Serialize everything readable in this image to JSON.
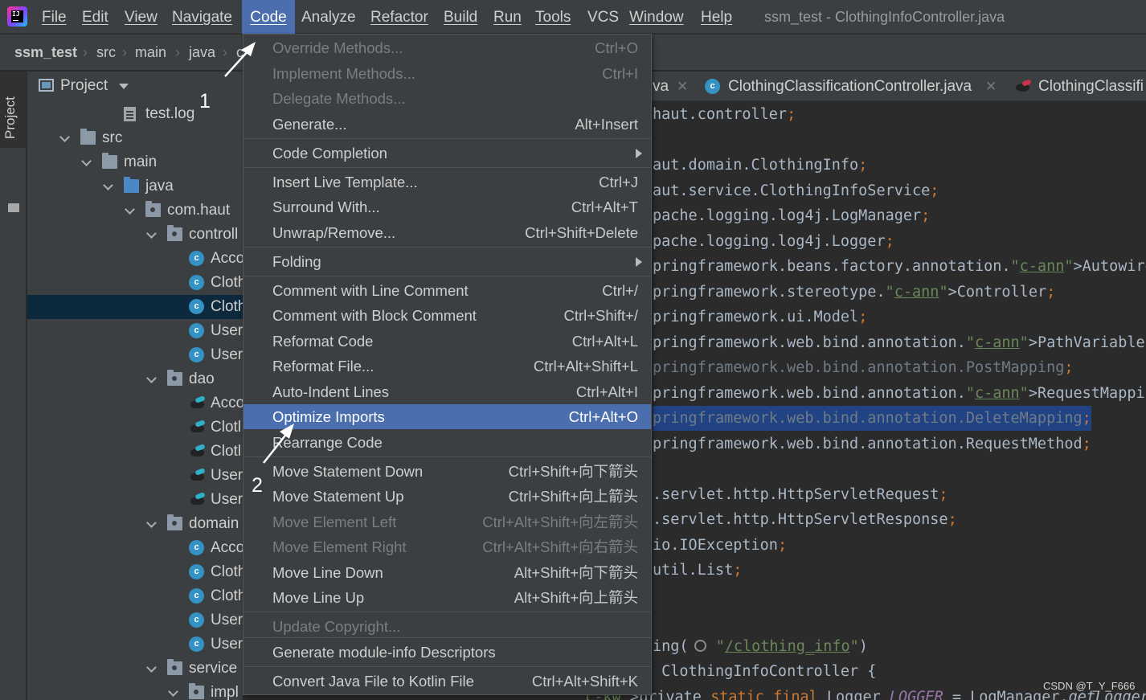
{
  "menubar": {
    "items": [
      "File",
      "Edit",
      "View",
      "Navigate",
      "Code",
      "Analyze",
      "Refactor",
      "Build",
      "Run",
      "Tools",
      "VCS",
      "Window",
      "Help"
    ],
    "active": "Code",
    "window_title": "ssm_test - ClothingInfoController.java"
  },
  "breadcrumb": [
    "ssm_test",
    "src",
    "main",
    "java",
    "c"
  ],
  "tool_strip": {
    "project_tab": "Project"
  },
  "project_panel": {
    "title": "Project",
    "tree": [
      {
        "label": "test.log",
        "icon": "file-icon"
      },
      {
        "label": "src",
        "icon": "folder-icon"
      },
      {
        "label": "main",
        "icon": "folder-icon"
      },
      {
        "label": "java",
        "icon": "source-folder-icon"
      },
      {
        "label": "com.haut",
        "icon": "package-icon"
      },
      {
        "label": "controll",
        "icon": "package-icon"
      },
      {
        "label": "Acco",
        "icon": "class-icon"
      },
      {
        "label": "Cloth",
        "icon": "class-icon"
      },
      {
        "label": "Cloth",
        "icon": "class-icon",
        "selected": true
      },
      {
        "label": "User",
        "icon": "class-icon"
      },
      {
        "label": "User",
        "icon": "class-icon"
      },
      {
        "label": "dao",
        "icon": "package-icon"
      },
      {
        "label": "Acco",
        "icon": "mapper-icon"
      },
      {
        "label": "Clotl",
        "icon": "mapper-icon"
      },
      {
        "label": "Clotl",
        "icon": "mapper-icon"
      },
      {
        "label": "User",
        "icon": "mapper-icon"
      },
      {
        "label": "User",
        "icon": "mapper-icon"
      },
      {
        "label": "domain",
        "icon": "package-icon"
      },
      {
        "label": "Acco",
        "icon": "class-icon"
      },
      {
        "label": "Cloth",
        "icon": "class-icon"
      },
      {
        "label": "Cloth",
        "icon": "class-icon"
      },
      {
        "label": "User",
        "icon": "class-icon"
      },
      {
        "label": "User",
        "icon": "class-icon"
      },
      {
        "label": "service",
        "icon": "package-icon"
      },
      {
        "label": "impl",
        "icon": "package-icon"
      }
    ]
  },
  "editor": {
    "tabs": [
      {
        "label": "va",
        "icon": "none"
      },
      {
        "label": "ClothingClassificationController.java",
        "icon": "class-icon"
      },
      {
        "label": "ClothingClassifi",
        "icon": "mapper-icon"
      }
    ],
    "code": [
      "haut.controller;",
      "",
      "aut.domain.ClothingInfo;",
      "aut.service.ClothingInfoService;",
      "pache.logging.log4j.LogManager;",
      "pache.logging.log4j.Logger;",
      "pringframework.beans.factory.annotation.Autowired;",
      "pringframework.stereotype.Controller;",
      "pringframework.ui.Model;",
      "pringframework.web.bind.annotation.PathVariable;",
      "pringframework.web.bind.annotation.PostMapping;",
      "pringframework.web.bind.annotation.RequestMapping;",
      "pringframework.web.bind.annotation.DeleteMapping;",
      "pringframework.web.bind.annotation.RequestMethod;",
      "",
      ".servlet.http.HttpServletRequest;",
      ".servlet.http.HttpServletResponse;",
      "io.IOException;",
      "util.List;",
      "",
      "",
      "ing(\"/clothing_info\")",
      " ClothingInfoController {",
      "private static final Logger LOGGER = LogManager.getLogger("
    ]
  },
  "code_menu": {
    "items": [
      {
        "label": "Override Methods...",
        "shortcut": "Ctrl+O",
        "disabled": true
      },
      {
        "label": "Implement Methods...",
        "shortcut": "Ctrl+I",
        "disabled": true
      },
      {
        "label": "Delegate Methods...",
        "shortcut": "",
        "disabled": true
      },
      {
        "label": "Generate...",
        "shortcut": "Alt+Insert"
      },
      {
        "label": "Code Completion",
        "shortcut": "",
        "submenu": true
      },
      {
        "label": "Insert Live Template...",
        "shortcut": "Ctrl+J"
      },
      {
        "label": "Surround With...",
        "shortcut": "Ctrl+Alt+T"
      },
      {
        "label": "Unwrap/Remove...",
        "shortcut": "Ctrl+Shift+Delete"
      },
      {
        "label": "Folding",
        "shortcut": "",
        "submenu": true
      },
      {
        "label": "Comment with Line Comment",
        "shortcut": "Ctrl+/"
      },
      {
        "label": "Comment with Block Comment",
        "shortcut": "Ctrl+Shift+/"
      },
      {
        "label": "Reformat Code",
        "shortcut": "Ctrl+Alt+L"
      },
      {
        "label": "Reformat File...",
        "shortcut": "Ctrl+Alt+Shift+L"
      },
      {
        "label": "Auto-Indent Lines",
        "shortcut": "Ctrl+Alt+I"
      },
      {
        "label": "Optimize Imports",
        "shortcut": "Ctrl+Alt+O",
        "highlighted": true
      },
      {
        "label": "Rearrange Code",
        "shortcut": ""
      },
      {
        "label": "Move Statement Down",
        "shortcut": "Ctrl+Shift+向下箭头"
      },
      {
        "label": "Move Statement Up",
        "shortcut": "Ctrl+Shift+向上箭头"
      },
      {
        "label": "Move Element Left",
        "shortcut": "Ctrl+Alt+Shift+向左箭头",
        "disabled": true
      },
      {
        "label": "Move Element Right",
        "shortcut": "Ctrl+Alt+Shift+向右箭头",
        "disabled": true
      },
      {
        "label": "Move Line Down",
        "shortcut": "Alt+Shift+向下箭头"
      },
      {
        "label": "Move Line Up",
        "shortcut": "Alt+Shift+向上箭头"
      },
      {
        "label": "Update Copyright...",
        "shortcut": "",
        "disabled": true
      },
      {
        "label": "Generate module-info Descriptors",
        "shortcut": ""
      },
      {
        "label": "Convert Java File to Kotlin File",
        "shortcut": "Ctrl+Alt+Shift+K"
      }
    ]
  },
  "annotations": {
    "step1": "1",
    "step2": "2"
  },
  "watermark": "CSDN @T_Y_F666",
  "colors": {
    "menu_highlight": "#4b6eaf",
    "selection": "#0d293e",
    "code_highlight": "#214283",
    "keyword": "#cc7832",
    "annotation": "#bbb529"
  }
}
